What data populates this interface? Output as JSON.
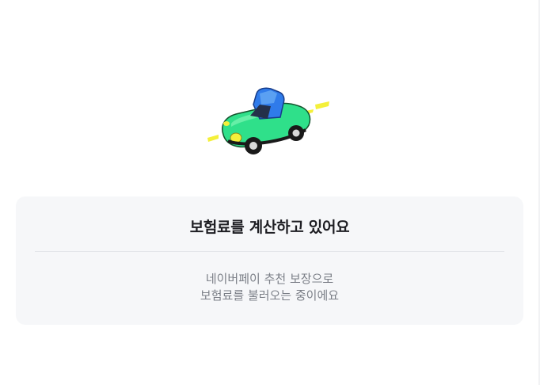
{
  "illustration": {
    "name": "car-icon",
    "colors": {
      "body": "#2fe08a",
      "roof": "#2f7bea",
      "wheel": "#1a1a1a",
      "light": "#f4f03a"
    }
  },
  "loading_card": {
    "title": "보험료를 계산하고 있어요",
    "description_line1": "네이버페이 추천 보장으로",
    "description_line2": "보험료를 불러오는 중이에요"
  }
}
